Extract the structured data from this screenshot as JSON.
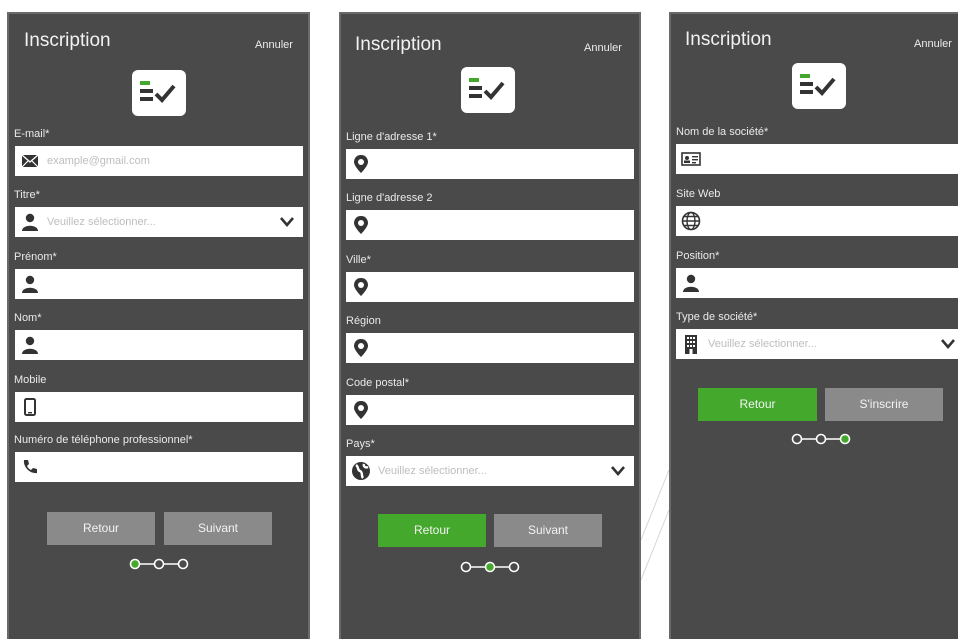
{
  "colors": {
    "panel": "#4a4a4a",
    "accent": "#43a82c",
    "button_disabled": "#8a8a8a",
    "field": "#ffffff"
  },
  "screens": [
    {
      "title": "Inscription",
      "cancel": "Annuler",
      "fields": [
        {
          "label": "E-mail*",
          "placeholder": "example@gmail.com",
          "icon": "envelope-icon"
        },
        {
          "label": "Titre*",
          "placeholder": "Veuillez sélectionner...",
          "icon": "person-icon",
          "dropdown": true
        },
        {
          "label": "Prénom*",
          "placeholder": "",
          "icon": "person-icon"
        },
        {
          "label": "Nom*",
          "placeholder": "",
          "icon": "person-icon"
        },
        {
          "label": "Mobile",
          "placeholder": "",
          "icon": "mobile-phone-icon"
        },
        {
          "label": "Numéro de téléphone professionnel*",
          "placeholder": "",
          "icon": "phone-handset-icon"
        }
      ],
      "buttons": {
        "back": "Retour",
        "next": "Suivant"
      },
      "current_step": 1,
      "total_steps": 3
    },
    {
      "title": "Inscription",
      "cancel": "Annuler",
      "fields": [
        {
          "label": "Ligne d'adresse 1*",
          "placeholder": "",
          "icon": "map-pin-icon"
        },
        {
          "label": "Ligne d'adresse 2",
          "placeholder": "",
          "icon": "map-pin-icon"
        },
        {
          "label": "Ville*",
          "placeholder": "",
          "icon": "map-pin-icon"
        },
        {
          "label": "Région",
          "placeholder": "",
          "icon": "map-pin-icon"
        },
        {
          "label": "Code postal*",
          "placeholder": "",
          "icon": "map-pin-icon"
        },
        {
          "label": "Pays*",
          "placeholder": "Veuillez sélectionner...",
          "icon": "globe-icon",
          "dropdown": true
        }
      ],
      "buttons": {
        "back": "Retour",
        "next": "Suivant"
      },
      "current_step": 2,
      "total_steps": 3
    },
    {
      "title": "Inscription",
      "cancel": "Annuler",
      "fields": [
        {
          "label": "Nom de la société*",
          "placeholder": "",
          "icon": "id-card-icon"
        },
        {
          "label": "Site Web",
          "placeholder": "",
          "icon": "web-globe-icon"
        },
        {
          "label": "Position*",
          "placeholder": "",
          "icon": "person-icon"
        },
        {
          "label": "Type de société*",
          "placeholder": "Veuillez sélectionner...",
          "icon": "building-icon",
          "dropdown": true
        }
      ],
      "buttons": {
        "back": "Retour",
        "submit": "S'inscrire"
      },
      "current_step": 3,
      "total_steps": 3
    }
  ]
}
